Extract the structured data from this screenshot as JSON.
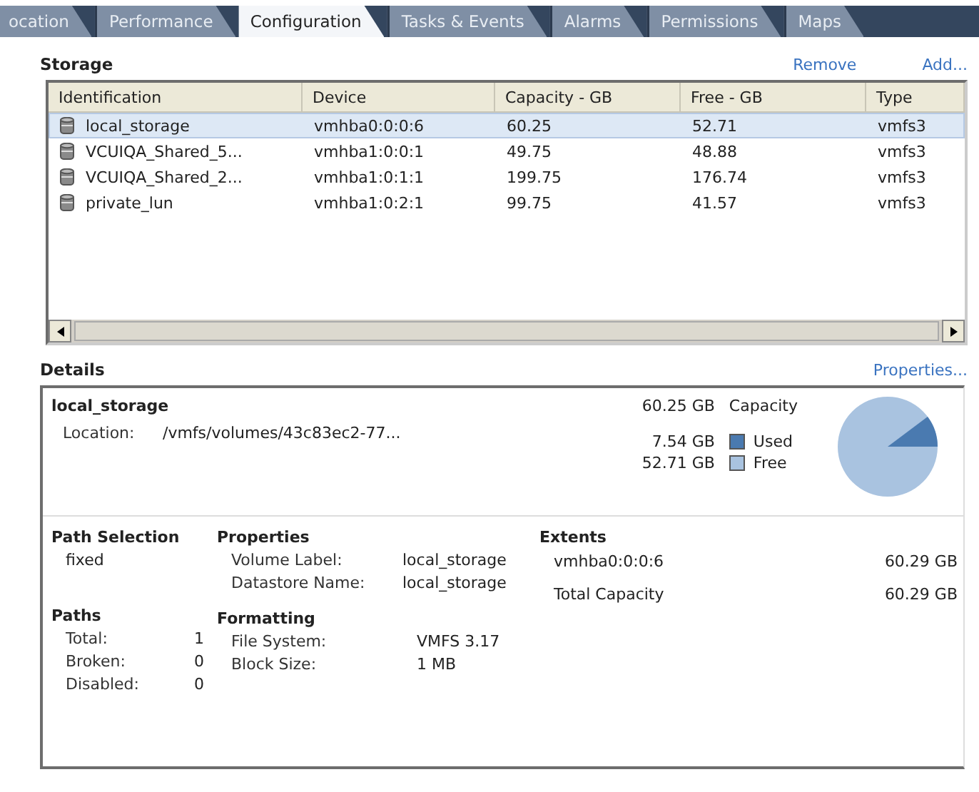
{
  "tabs": [
    {
      "label": "ocation",
      "selected": false
    },
    {
      "label": "Performance",
      "selected": false
    },
    {
      "label": "Configuration",
      "selected": true
    },
    {
      "label": "Tasks & Events",
      "selected": false
    },
    {
      "label": "Alarms",
      "selected": false
    },
    {
      "label": "Permissions",
      "selected": false
    },
    {
      "label": "Maps",
      "selected": false
    }
  ],
  "storage": {
    "title": "Storage",
    "actions": [
      "Remove",
      "Add..."
    ],
    "columns": [
      "Identification",
      "Device",
      "Capacity - GB",
      "Free - GB",
      "Type"
    ],
    "rows": [
      {
        "selected": true,
        "cells": [
          "local_storage",
          "vmhba0:0:0:6",
          "60.25",
          "52.71",
          "vmfs3"
        ]
      },
      {
        "selected": false,
        "cells": [
          "VCUIQA_Shared_5...",
          "vmhba1:0:0:1",
          "49.75",
          "48.88",
          "vmfs3"
        ]
      },
      {
        "selected": false,
        "cells": [
          "VCUIQA_Shared_2...",
          "vmhba1:0:1:1",
          "199.75",
          "176.74",
          "vmfs3"
        ]
      },
      {
        "selected": false,
        "cells": [
          "private_lun",
          "vmhba1:0:2:1",
          "99.75",
          "41.57",
          "vmfs3"
        ]
      }
    ]
  },
  "details": {
    "title": "Details",
    "action": "Properties...",
    "name": "local_storage",
    "location_label": "Location:",
    "location": "/vmfs/volumes/43c83ec2-77...",
    "capacity": {
      "value": "60.25 GB",
      "label": "Capacity"
    },
    "legend": [
      {
        "value": "7.54 GB",
        "label": "Used",
        "color": "#4a7ab0"
      },
      {
        "value": "52.71 GB",
        "label": "Free",
        "color": "#a9c3e0"
      }
    ],
    "path_selection": {
      "title": "Path Selection",
      "value": "fixed"
    },
    "paths": {
      "title": "Paths",
      "items": [
        {
          "label": "Total:",
          "value": "1"
        },
        {
          "label": "Broken:",
          "value": "0"
        },
        {
          "label": "Disabled:",
          "value": "0"
        }
      ]
    },
    "properties": {
      "title": "Properties",
      "items": [
        {
          "label": "Volume Label:",
          "value": "local_storage"
        },
        {
          "label": "Datastore Name:",
          "value": "local_storage"
        }
      ]
    },
    "formatting": {
      "title": "Formatting",
      "items": [
        {
          "label": "File System:",
          "value": "VMFS 3.17"
        },
        {
          "label": "Block Size:",
          "value": "1 MB"
        }
      ]
    },
    "extents": {
      "title": "Extents",
      "items": [
        {
          "label": "vmhba0:0:0:6",
          "value": "60.29 GB"
        },
        {
          "label": "Total Capacity",
          "value": "60.29 GB"
        }
      ]
    }
  }
}
